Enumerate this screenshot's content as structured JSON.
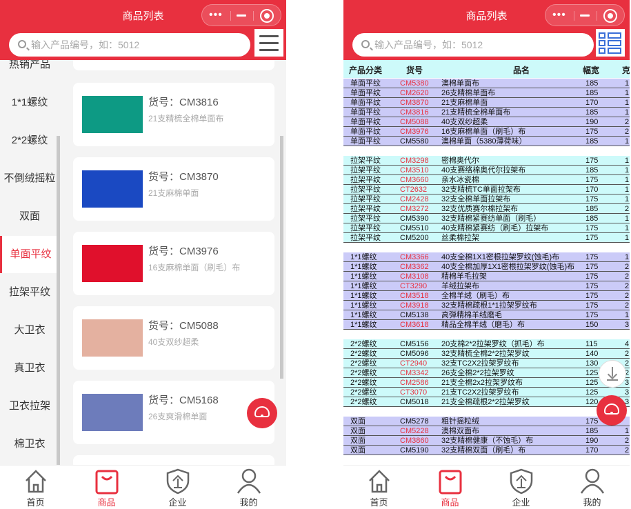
{
  "app": {
    "title": "商品列表",
    "search_placeholder": "输入产品编号，如：5012",
    "accent": "#e8303f"
  },
  "sidebar": {
    "items": [
      {
        "label": "热销产品",
        "active": false
      },
      {
        "label": "1*1螺纹",
        "active": false
      },
      {
        "label": "2*2螺纹",
        "active": false
      },
      {
        "label": "不倒绒摇粒",
        "active": false
      },
      {
        "label": "双面",
        "active": false
      },
      {
        "label": "单面平纹",
        "active": true
      },
      {
        "label": "拉架平纹",
        "active": false
      },
      {
        "label": "大卫衣",
        "active": false
      },
      {
        "label": "真卫衣",
        "active": false
      },
      {
        "label": "卫衣拉架",
        "active": false
      },
      {
        "label": "棉卫衣",
        "active": false
      }
    ]
  },
  "products": [
    {
      "code": "货号：CM3816",
      "desc": "21支精梳全棉单面布",
      "color": "#0d9a84"
    },
    {
      "code": "货号：CM3870",
      "desc": "21支麻棉单面",
      "color": "#1a49c2"
    },
    {
      "code": "货号：CM3976",
      "desc": "16支麻棉单面（刷毛）布",
      "color": "#e0102c"
    },
    {
      "code": "货号：CM5088",
      "desc": "40支双纱超柔",
      "color": "#e4b1a0"
    },
    {
      "code": "货号：CM5168",
      "desc": "26支爽滑棉单面",
      "color": "#6d7cbb"
    }
  ],
  "table": {
    "headers": [
      "产品分类",
      "货号",
      "品名",
      "幅宽",
      "克"
    ],
    "groups": [
      {
        "color": "#cbcbf8",
        "rows": [
          [
            "单面平纹",
            "CM5380",
            "澳棉单面布",
            "185",
            "1",
            true
          ],
          [
            "单面平纹",
            "CM2620",
            "26支精棉单面布",
            "185",
            "1",
            true
          ],
          [
            "单面平纹",
            "CM3870",
            "21支麻棉单面",
            "170",
            "1",
            true
          ],
          [
            "单面平纹",
            "CM3816",
            "21支精梳全棉单面布",
            "185",
            "1",
            true
          ],
          [
            "单面平纹",
            "CM5088",
            "40支双纱超柔",
            "190",
            "2",
            true
          ],
          [
            "单面平纹",
            "CM3976",
            "16支麻棉单面（刷毛）布",
            "175",
            "2",
            true
          ],
          [
            "单面平纹",
            "CM5580",
            "澳棉单面（5380薄荷味）",
            "185",
            "1",
            false
          ]
        ]
      },
      {
        "color": "#cdfafa",
        "rows": [
          [
            "拉架平纹",
            "CM3298",
            "密棉奥代尔",
            "175",
            "1",
            true
          ],
          [
            "拉架平纹",
            "CM3510",
            "40支赛络棉奥代尔拉架布",
            "185",
            "1",
            true
          ],
          [
            "拉架平纹",
            "CM3660",
            "亲水冰瓷棉",
            "175",
            "1",
            true
          ],
          [
            "拉架平纹",
            "CT2632",
            "32支精梳TC单面拉架布",
            "170",
            "1",
            true
          ],
          [
            "拉架平纹",
            "CM2428",
            "32支全棉单面拉架布",
            "175",
            "1",
            true
          ],
          [
            "拉架平纹",
            "CM3272",
            "32支优质赛尔棉拉架布",
            "185",
            "2",
            true
          ],
          [
            "拉架平纹",
            "CM5390",
            "32支精棉紧赛纺单面（刷毛）",
            "185",
            "1",
            false
          ],
          [
            "拉架平纹",
            "CM5510",
            "40支精棉紧赛纺（刷毛）拉架布",
            "175",
            "1",
            false
          ],
          [
            "拉架平纹",
            "CM5200",
            "丝柔棉拉架",
            "175",
            "1",
            false
          ]
        ]
      },
      {
        "color": "#cbcbf8",
        "rows": [
          [
            "1*1螺纹",
            "CM3366",
            "40支全棉1X1密根拉架罗纹(蚀毛)布",
            "175",
            "1",
            true
          ],
          [
            "1*1螺纹",
            "CM3362",
            "40支全棉加厚1X1密根拉架罗纹(蚀毛)布",
            "175",
            "2",
            true
          ],
          [
            "1*1螺纹",
            "CM3108",
            "精棉羊毛拉架",
            "175",
            "2",
            true
          ],
          [
            "1*1螺纹",
            "CT3290",
            "羊绒拉架布",
            "175",
            "2",
            true
          ],
          [
            "1*1螺纹",
            "CM3518",
            "全棉羊绒（刷毛）布",
            "175",
            "2",
            true
          ],
          [
            "1*1螺纹",
            "CM3918",
            "32支精棉疏根1*1拉架罗纹布",
            "175",
            "2",
            true
          ],
          [
            "1*1螺纹",
            "CM5138",
            "高弹精棉羊绒磨毛",
            "175",
            "1",
            false
          ],
          [
            "1*1螺纹",
            "CM3618",
            "精品全棉羊绒（磨毛）布",
            "150",
            "3",
            true
          ]
        ]
      },
      {
        "color": "#cdfafa",
        "rows": [
          [
            "2*2螺纹",
            "CM5156",
            "20支棉2*2拉架罗纹（抓毛）布",
            "115",
            "4",
            false
          ],
          [
            "2*2螺纹",
            "CM5096",
            "32支精梳全棉2*2拉架罗纹",
            "140",
            "2",
            false
          ],
          [
            "2*2螺纹",
            "CT2940",
            "32支TC2X2拉架罗纹布",
            "130",
            "2",
            true
          ],
          [
            "2*2螺纹",
            "CM3342",
            "26支全棉2*2拉架罗纹",
            "125",
            "2",
            true
          ],
          [
            "2*2螺纹",
            "CM2586",
            "21支全棉2x2拉架罗纹布",
            "125",
            "3",
            true
          ],
          [
            "2*2螺纹",
            "CT3070",
            "21支TC2X2拉架罗纹布",
            "125",
            "3",
            true
          ],
          [
            "2*2螺纹",
            "CM5018",
            "21支全棉疏根2*2拉架罗纹",
            "120",
            "3",
            false
          ]
        ]
      },
      {
        "color": "#cbcbf8",
        "rows": [
          [
            "双面",
            "CM5278",
            "粗针摇粒绒",
            "175",
            "",
            false
          ],
          [
            "双面",
            "CM5228",
            "澳棉双面布",
            "185",
            "1",
            true
          ],
          [
            "双面",
            "CM3860",
            "32支精棉健康（不蚀毛）布",
            "190",
            "2",
            true
          ],
          [
            "双面",
            "CM5190",
            "32支精棉双面（刷毛）布",
            "170",
            "2",
            false
          ]
        ]
      }
    ]
  },
  "tabs": [
    {
      "label": "首页",
      "icon": "home-icon",
      "active": false
    },
    {
      "label": "商品",
      "icon": "bag-icon",
      "active": true
    },
    {
      "label": "企业",
      "icon": "company-shield-icon",
      "active": false
    },
    {
      "label": "我的",
      "icon": "user-icon",
      "active": false
    }
  ]
}
